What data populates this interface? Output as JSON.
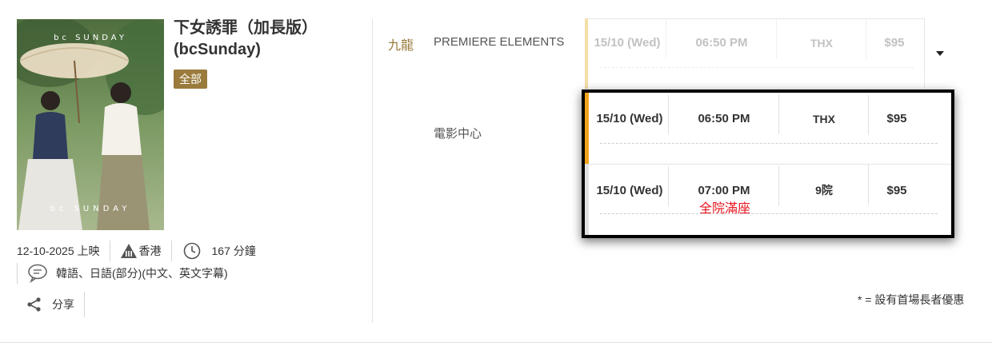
{
  "movie": {
    "title_line1": "下女誘罪（加長版）",
    "title_line2": "(bcSunday)",
    "tag": "全部",
    "poster_text_top": "bc SUNDAY",
    "poster_text_bottom": "bc SUNDAY",
    "release": "12-10-2025 上映",
    "rating": "香港",
    "duration": "167 分鐘",
    "language": "韓語、日語(部分)(中文、英文字幕)",
    "share": "分享",
    "icons": [
      "rating-triangle-icon",
      "clock-icon",
      "speech-bubble-icon",
      "share-icon"
    ]
  },
  "showtimes": {
    "region": "九龍",
    "cinemas": [
      {
        "name": "PREMIERE ELEMENTS",
        "sessions": [
          {
            "date": "15/10 (Wed)",
            "time": "06:50 PM",
            "hall": "THX",
            "price": "$95"
          }
        ]
      },
      {
        "name": "電影中心",
        "sessions": [
          {
            "date": "15/10 (Wed)",
            "time": "06:50 PM",
            "hall": "THX",
            "price": "$95",
            "status": ""
          },
          {
            "date": "15/10 (Wed)",
            "time": "07:00 PM",
            "hall": "9院",
            "price": "$95",
            "status": "全院滿座"
          }
        ]
      }
    ],
    "footnote": "* = 設有首場長者優惠"
  },
  "colors": {
    "gold": "#9a7b3c",
    "accent_orange": "#f0a21a",
    "accent_faded": "#f6dea9",
    "soldout_red": "#e8141e"
  }
}
